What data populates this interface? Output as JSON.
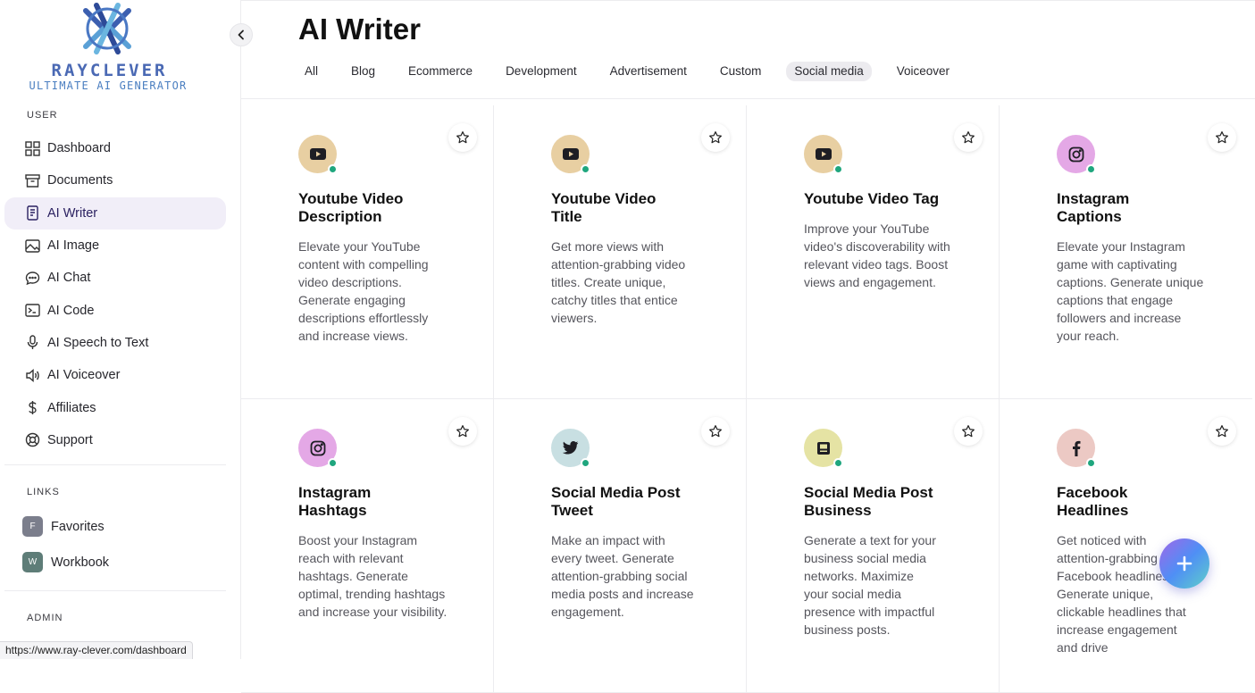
{
  "brand": {
    "name": "RAYCLEVER",
    "tagline": "ULTIMATE AI GENERATOR"
  },
  "sidebar": {
    "user_label": "USER",
    "items": [
      {
        "label": "Dashboard",
        "icon": "grid-icon"
      },
      {
        "label": "Documents",
        "icon": "archive-icon"
      },
      {
        "label": "AI Writer",
        "icon": "document-icon",
        "active": true
      },
      {
        "label": "AI Image",
        "icon": "image-icon"
      },
      {
        "label": "AI Chat",
        "icon": "chat-bubble-icon"
      },
      {
        "label": "AI Code",
        "icon": "terminal-icon"
      },
      {
        "label": "AI Speech to Text",
        "icon": "microphone-icon"
      },
      {
        "label": "AI Voiceover",
        "icon": "speaker-icon"
      },
      {
        "label": "Affiliates",
        "icon": "dollar-icon"
      },
      {
        "label": "Support",
        "icon": "lifebuoy-icon"
      }
    ],
    "links_label": "LINKS",
    "links": [
      {
        "label": "Favorites",
        "badge": "F",
        "color": "#7b7e8c"
      },
      {
        "label": "Workbook",
        "badge": "W",
        "color": "#5e7d78"
      }
    ],
    "admin_label": "ADMIN"
  },
  "status_bar_url": "https://www.ray-clever.com/dashboard",
  "page": {
    "title": "AI Writer",
    "tabs": [
      {
        "label": "All"
      },
      {
        "label": "Blog"
      },
      {
        "label": "Ecommerce"
      },
      {
        "label": "Development"
      },
      {
        "label": "Advertisement"
      },
      {
        "label": "Custom"
      },
      {
        "label": "Social media",
        "active": true
      },
      {
        "label": "Voiceover"
      }
    ]
  },
  "cards": [
    {
      "title": "Youtube Video Description",
      "description": "Elevate your YouTube content with compelling video descriptions. Generate engaging descriptions effortlessly and increase views.",
      "icon": "youtube-icon",
      "bg": "#e8cfa2"
    },
    {
      "title": "Youtube Video Title",
      "description": "Get more views with attention-grabbing video titles. Create unique, catchy titles that entice viewers.",
      "icon": "youtube-icon",
      "bg": "#e8cfa2"
    },
    {
      "title": "Youtube Video Tag",
      "description": "Improve your YouTube video's discoverability with relevant video tags. Boost views and engagement.",
      "icon": "youtube-icon",
      "bg": "#e8cfa2"
    },
    {
      "title": "Instagram Captions",
      "description": "Elevate your Instagram game with captivating captions. Generate unique captions that engage followers and increase your reach.",
      "icon": "instagram-icon",
      "bg": "#e4a8e6"
    },
    {
      "title": "Instagram Hashtags",
      "description": "Boost your Instagram reach with relevant hashtags. Generate optimal, trending hashtags and increase your visibility.",
      "icon": "instagram-icon",
      "bg": "#e4a8e6"
    },
    {
      "title": "Social Media Post Tweet",
      "description": "Make an impact with every tweet. Generate attention-grabbing social media posts and increase engagement.",
      "icon": "twitter-icon",
      "bg": "#c8dfe2"
    },
    {
      "title": "Social Media Post Business",
      "description": "Generate a text for your business social media networks. Maximize your social media presence with impactful business posts.",
      "icon": "business-card-icon",
      "bg": "#e5e3a4"
    },
    {
      "title": "Facebook Headlines",
      "description": "Get noticed with attention-grabbing Facebook headlines. Generate unique, clickable headlines that increase engagement and drive",
      "icon": "facebook-icon",
      "bg": "#ecc9c4"
    }
  ]
}
